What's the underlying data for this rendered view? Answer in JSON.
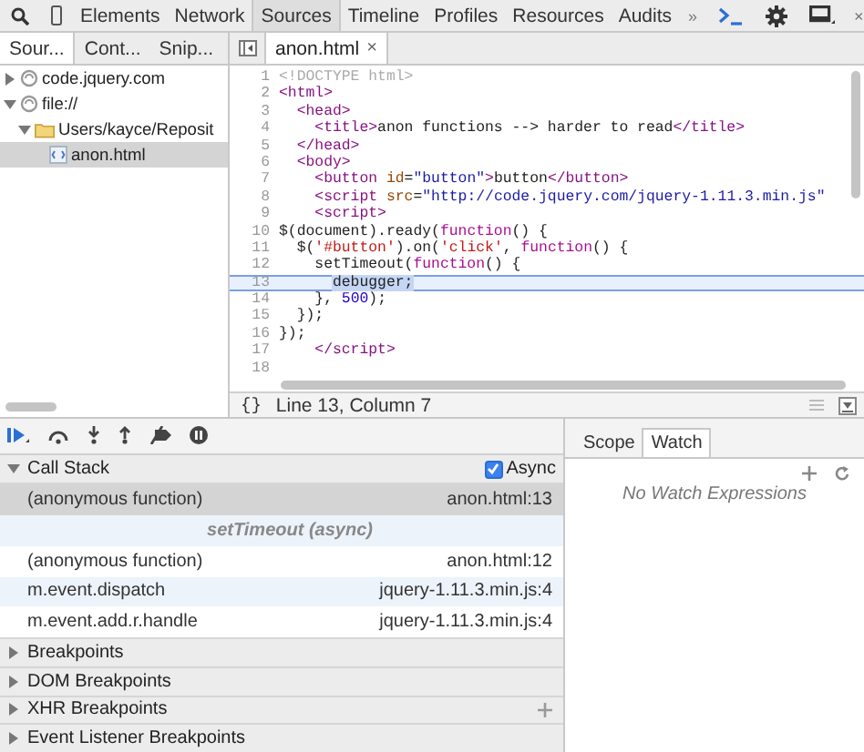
{
  "toolbar": {
    "tabs": [
      {
        "label": "Elements",
        "selected": false
      },
      {
        "label": "Network",
        "selected": false
      },
      {
        "label": "Sources",
        "selected": true
      },
      {
        "label": "Timeline",
        "selected": false
      },
      {
        "label": "Profiles",
        "selected": false
      },
      {
        "label": "Resources",
        "selected": false
      },
      {
        "label": "Audits",
        "selected": false
      }
    ],
    "more": "»",
    "close": "×"
  },
  "navigator": {
    "tabs": [
      {
        "label": "Sour...",
        "selected": true
      },
      {
        "label": "Cont...",
        "selected": false
      },
      {
        "label": "Snip...",
        "selected": false
      }
    ],
    "tree": [
      {
        "label": "code.jquery.com",
        "kind": "domain",
        "expanded": false,
        "selected": false
      },
      {
        "label": "file://",
        "kind": "domain",
        "expanded": true,
        "selected": false,
        "children": [
          {
            "label": "Users/kayce/Reposit",
            "kind": "folder",
            "expanded": true,
            "selected": false,
            "children": [
              {
                "label": "anon.html",
                "kind": "file",
                "selected": true
              }
            ]
          }
        ]
      }
    ]
  },
  "editor": {
    "tab": {
      "label": "anon.html",
      "close": "×"
    },
    "lines": [
      {
        "number": "1",
        "current": false,
        "tokens": [
          {
            "kind": "doctype",
            "text": "<!DOCTYPE html>"
          }
        ]
      },
      {
        "number": "2",
        "current": false,
        "tokens": [
          {
            "kind": "tag",
            "text": "<html>"
          }
        ]
      },
      {
        "number": "3",
        "current": false,
        "tokens": [
          {
            "kind": "tag",
            "text": "  <head>"
          }
        ]
      },
      {
        "number": "4",
        "current": false,
        "tokens": [
          {
            "kind": "tag",
            "text": "    <title>"
          },
          {
            "kind": "text",
            "text": "anon functions --> harder to read"
          },
          {
            "kind": "tag",
            "text": "</title>"
          }
        ]
      },
      {
        "number": "5",
        "current": false,
        "tokens": [
          {
            "kind": "tag",
            "text": "  </head>"
          }
        ]
      },
      {
        "number": "6",
        "current": false,
        "tokens": [
          {
            "kind": "tag",
            "text": "  <body>"
          }
        ]
      },
      {
        "number": "7",
        "current": false,
        "tokens": [
          {
            "kind": "tag",
            "text": "    <button "
          },
          {
            "kind": "attr",
            "text": "id"
          },
          {
            "kind": "text",
            "text": "="
          },
          {
            "kind": "value",
            "text": "\"button\""
          },
          {
            "kind": "tag",
            "text": ">"
          },
          {
            "kind": "text",
            "text": "button"
          },
          {
            "kind": "tag",
            "text": "</button>"
          }
        ]
      },
      {
        "number": "8",
        "current": false,
        "tokens": [
          {
            "kind": "tag",
            "text": "    <script "
          },
          {
            "kind": "attr",
            "text": "src"
          },
          {
            "kind": "text",
            "text": "="
          },
          {
            "kind": "value",
            "text": "\"http://code.jquery.com/jquery-1.11.3.min.js\""
          }
        ]
      },
      {
        "number": "9",
        "current": false,
        "tokens": [
          {
            "kind": "tag",
            "text": "    <script>"
          }
        ]
      },
      {
        "number": "10",
        "current": false,
        "tokens": [
          {
            "kind": "text",
            "text": "$(document).ready("
          },
          {
            "kind": "keyword",
            "text": "function"
          },
          {
            "kind": "text",
            "text": "() {"
          }
        ]
      },
      {
        "number": "11",
        "current": false,
        "tokens": [
          {
            "kind": "text",
            "text": "  $("
          },
          {
            "kind": "string",
            "text": "'#button'"
          },
          {
            "kind": "text",
            "text": ").on("
          },
          {
            "kind": "string",
            "text": "'click'"
          },
          {
            "kind": "text",
            "text": ", "
          },
          {
            "kind": "keyword",
            "text": "function"
          },
          {
            "kind": "text",
            "text": "() {"
          }
        ]
      },
      {
        "number": "12",
        "current": false,
        "tokens": [
          {
            "kind": "text",
            "text": "    setTimeout("
          },
          {
            "kind": "keyword",
            "text": "function"
          },
          {
            "kind": "text",
            "text": "() {"
          }
        ]
      },
      {
        "number": "13",
        "current": true,
        "tokens": [
          {
            "kind": "selection",
            "text": "debugger;"
          }
        ]
      },
      {
        "number": "14",
        "current": false,
        "tokens": [
          {
            "kind": "text",
            "text": "    }, "
          },
          {
            "kind": "number",
            "text": "500"
          },
          {
            "kind": "text",
            "text": ");"
          }
        ]
      },
      {
        "number": "15",
        "current": false,
        "tokens": [
          {
            "kind": "text",
            "text": "  });"
          }
        ]
      },
      {
        "number": "16",
        "current": false,
        "tokens": [
          {
            "kind": "text",
            "text": "});"
          }
        ]
      },
      {
        "number": "17",
        "current": false,
        "tokens": [
          {
            "kind": "tag",
            "text": "    </script>"
          }
        ]
      },
      {
        "number": "18",
        "current": false
      }
    ],
    "status": {
      "pretty_print": "{}",
      "position": "Line 13, Column 7"
    }
  },
  "call_stack": {
    "title": "Call Stack",
    "expanded": true,
    "async": {
      "label": "Async",
      "checked": true
    },
    "frames": [
      {
        "kind": "frame",
        "name": "(anonymous function)",
        "location": "anon.html:13",
        "selected": true,
        "hovered": false
      },
      {
        "kind": "async",
        "name": "setTimeout (async)",
        "selected": false
      },
      {
        "kind": "frame",
        "name": "(anonymous function)",
        "location": "anon.html:12",
        "selected": false,
        "hovered": false
      },
      {
        "kind": "frame",
        "name": "m.event.dispatch",
        "location": "jquery-1.11.3.min.js:4",
        "selected": false,
        "hovered": true
      },
      {
        "kind": "frame",
        "name": "m.event.add.r.handle",
        "location": "jquery-1.11.3.min.js:4",
        "selected": false,
        "hovered": false
      }
    ]
  },
  "panes": [
    {
      "title": "Breakpoints",
      "expanded": false,
      "add": false
    },
    {
      "title": "DOM Breakpoints",
      "expanded": false,
      "add": false
    },
    {
      "title": "XHR Breakpoints",
      "expanded": false,
      "add": true
    },
    {
      "title": "Event Listener Breakpoints",
      "expanded": false,
      "add": false
    }
  ],
  "sidebar": {
    "tabs": [
      {
        "label": "Scope",
        "selected": false
      },
      {
        "label": "Watch",
        "selected": true
      }
    ],
    "empty": "No Watch Expressions"
  }
}
